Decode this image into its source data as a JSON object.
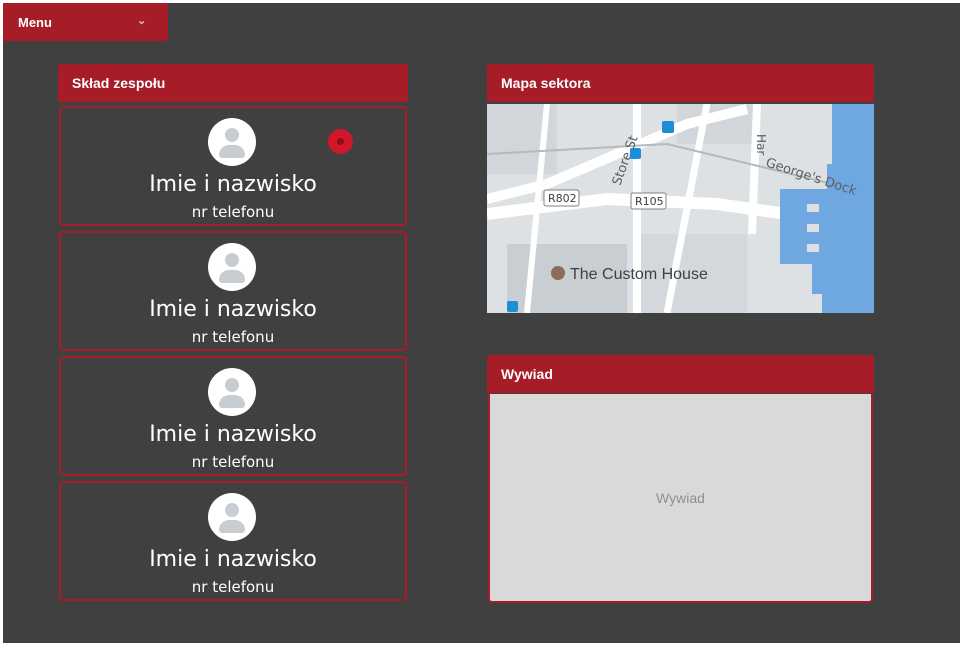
{
  "menu": {
    "label": "Menu",
    "icon": "chevron-down-icon"
  },
  "team": {
    "title": "Skład zespołu",
    "members": [
      {
        "name": "Imie i nazwisko",
        "phone": "nr telefonu"
      },
      {
        "name": "Imie i nazwisko",
        "phone": "nr telefonu"
      },
      {
        "name": "Imie i nazwisko",
        "phone": "nr telefonu"
      },
      {
        "name": "Imie i nazwisko",
        "phone": "nr telefonu"
      }
    ]
  },
  "map": {
    "title": "Mapa sektora",
    "labels": {
      "store_st": "Store St",
      "georges_dock": "George's Dock",
      "r802": "R802",
      "r105": "R105",
      "custom_house": "The Custom House",
      "har": "Har"
    }
  },
  "wywiad": {
    "title": "Wywiad",
    "placeholder": "Wywiad"
  },
  "colors": {
    "accent": "#a61c27",
    "background": "#404040",
    "record": "#d3172a",
    "water": "#6fa8e0"
  }
}
